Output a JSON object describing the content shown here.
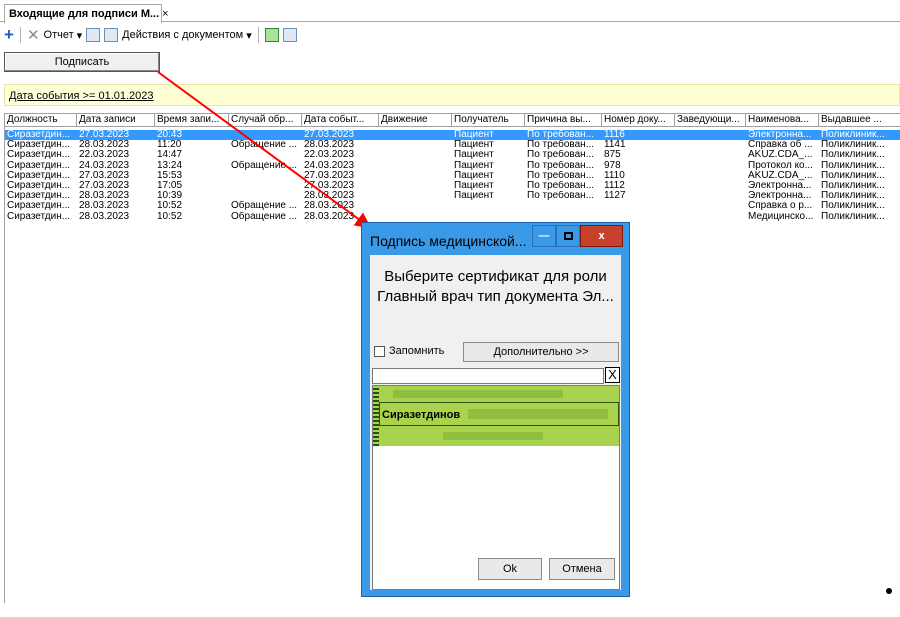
{
  "tab": {
    "title": "Входящие для подписи М...",
    "close": "×"
  },
  "toolbar": {
    "report": "Отчет",
    "actions": "Действия с документом"
  },
  "sign_button": "Подписать",
  "filter": "Дата события >= 01.01.2023",
  "columns": [
    "Должность",
    "Дата записи",
    "Время запи...",
    "Случай обр...",
    "Дата событ...",
    "Движение",
    "Получатель",
    "Причина вы...",
    "Номер доку...",
    "Заведующи...",
    "Наименова...",
    "Выдавшее ..."
  ],
  "rows": [
    [
      "Сиразетдин...",
      "27.03.2023",
      "20:43",
      "",
      "27.03.2023",
      "",
      "Пациент",
      "По требован...",
      "1116",
      "",
      "Электронна...",
      "Поликлиник..."
    ],
    [
      "Сиразетдин...",
      "28.03.2023",
      "11:20",
      "Обращение ...",
      "28.03.2023",
      "",
      "Пациент",
      "По требован...",
      "1141",
      "",
      "Справка об ...",
      "Поликлиник..."
    ],
    [
      "Сиразетдин...",
      "22.03.2023",
      "14:47",
      "",
      "22.03.2023",
      "",
      "Пациент",
      "По требован...",
      "875",
      "",
      "AKUZ.CDA_...",
      "Поликлиник..."
    ],
    [
      "Сиразетдин...",
      "24.03.2023",
      "13:24",
      "Обращение ...",
      "24.03.2023",
      "",
      "Пациент",
      "По требован...",
      "978",
      "",
      "Протокол ко...",
      "Поликлиник..."
    ],
    [
      "Сиразетдин...",
      "27.03.2023",
      "15:53",
      "",
      "27.03.2023",
      "",
      "Пациент",
      "По требован...",
      "1110",
      "",
      "AKUZ.CDA_...",
      "Поликлиник..."
    ],
    [
      "Сиразетдин...",
      "27.03.2023",
      "17:05",
      "",
      "27.03.2023",
      "",
      "Пациент",
      "По требован...",
      "1112",
      "",
      "Электронна...",
      "Поликлиник..."
    ],
    [
      "Сиразетдин...",
      "28.03.2023",
      "10:39",
      "",
      "28.03.2023",
      "",
      "Пациент",
      "По требован...",
      "1127",
      "",
      "Электронна...",
      "Поликлиник..."
    ],
    [
      "Сиразетдин...",
      "28.03.2023",
      "10:52",
      "Обращение ...",
      "28.03.2023",
      "",
      "",
      "",
      "",
      "",
      "Справка о р...",
      "Поликлиник..."
    ],
    [
      "Сиразетдин...",
      "28.03.2023",
      "10:52",
      "Обращение ...",
      "28.03.2023",
      "",
      "",
      "",
      "",
      "",
      "Медицинско...",
      "Поликлиник..."
    ]
  ],
  "dialog": {
    "title": "Подпись медицинской...",
    "prompt_line1": "Выберите сертификат для роли",
    "prompt_line2": "Главный врач тип документа Эл...",
    "remember": "Запомнить",
    "more": "Дополнительно >>",
    "clear": "X",
    "cert_name": "Сиразетдинов",
    "ok": "Ok",
    "cancel": "Отмена",
    "close": "x",
    "minimize": "—"
  },
  "colors": {
    "selected_row": "#3399ff",
    "dialog_frame": "#3b9ae8",
    "close_button": "#c7422d",
    "cert_selected": "#a9d34c",
    "filter_bg": "#ffffd5",
    "arrow": "#ff0000"
  }
}
